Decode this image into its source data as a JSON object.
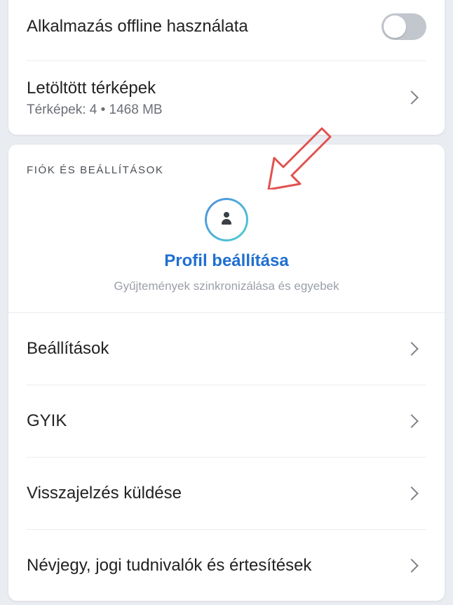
{
  "offline_card": {
    "offline_label": "Alkalmazás offline használata",
    "offline_toggle_on": false,
    "maps_label": "Letöltött térképek",
    "maps_sub": "Térképek: 4 • 1468 MB"
  },
  "account_card": {
    "section_header": "FIÓK ÉS BEÁLLÍTÁSOK",
    "profile_title": "Profil beállítása",
    "profile_sub": "Gyűjtemények szinkronizálása és egyebek",
    "items": [
      {
        "label": "Beállítások"
      },
      {
        "label": "GYIK"
      },
      {
        "label": "Visszajelzés küldése"
      },
      {
        "label": "Névjegy, jogi tudnivalók és értesítések"
      }
    ]
  },
  "colors": {
    "accent": "#1f6fd1",
    "annotation_arrow": "#e0524f",
    "background": "#e9ecf1"
  }
}
